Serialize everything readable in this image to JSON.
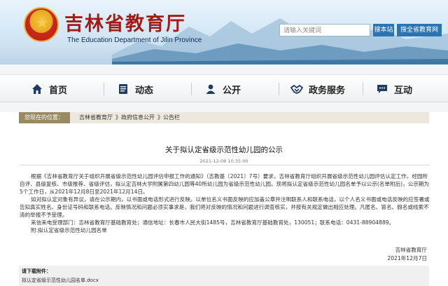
{
  "header": {
    "site_title": "吉林省教育厅",
    "site_subtitle": "The Education Department of Jilin Province",
    "search_placeholder": "请输入关键词",
    "search_button": "搜本站",
    "search_all_button": "搜全省教育网"
  },
  "nav": {
    "items": [
      {
        "label": "首页",
        "icon": "house-icon"
      },
      {
        "label": "动态",
        "icon": "document-icon"
      },
      {
        "label": "公开",
        "icon": "person-icon"
      },
      {
        "label": "政务服务",
        "icon": "handshake-icon"
      },
      {
        "label": "互动",
        "icon": "chat-icon"
      }
    ]
  },
  "breadcrumb": {
    "label": "您现在的位置：",
    "path": [
      "吉林省教育厅",
      "》政府信息公开",
      "》公告栏"
    ]
  },
  "article": {
    "title": "关于拟认定省级示范性幼儿园的公示",
    "date": "2021-12-08 10:35:00",
    "para1": "根据《吉林省教育厅关于组织开展省级示范性幼儿园评估申报工作的通知》（吉教基〔2021〕7号）要求，吉林省教育厅组织开展省级示范性幼儿园评估认定工作。经园所自评、县级复核、市级推荐、省级评估，拟认定吉林大学附属第四幼儿园等40所幼儿园为省级示范性幼儿园。现将拟认定省级示范性幼儿园名单予以公示(名单附后)，公示期为5个工作日，从2021年12月8日至2021年12月14日。",
    "para2": "如对拟认定对象有异议，请在公示期内，以书面或电话形式进行反映。以单位名义书面反映的应加盖公章并注明联系人和联系电话，以个人名义书面或电话反映的应签署或告知真实姓名、身份证号码和联系电话。反映情况和问题必须实事求是，我们将对反映的情况和问题进行调查核实，并按有关规定做出相应处理。凡匿名、冒名、假名或线索不清的举报不予受理。",
    "para3": "来信来电受理部门：吉林省教育厅基础教育处；通信地址：长春市人民大街1485号，吉林省教育厅基础教育处，130051；联系电话：0431-88904889。",
    "para4": "附:拟认定省级示范性幼儿园名单",
    "signature": "吉林省教育厅",
    "sign_date": "2021年12月7日"
  },
  "attachments": {
    "title": "请下载附件：",
    "files": [
      "拟认定省级示范性幼儿园名单.docx"
    ]
  },
  "colors": {
    "title_red": "#a11c17",
    "button_blue": "#2a74b4",
    "crumb_tab": "#9a8a62"
  }
}
